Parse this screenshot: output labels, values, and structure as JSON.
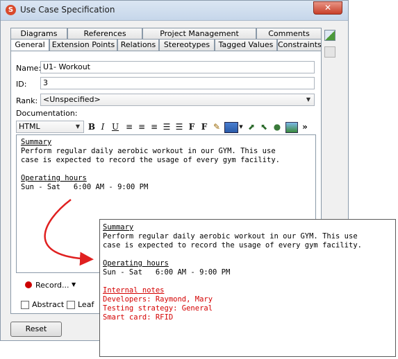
{
  "window": {
    "title": "Use Case Specification",
    "close_glyph": "✕",
    "app_icon": "app-logo-icon"
  },
  "tabs_row1": [
    "Diagrams",
    "References",
    "Project Management",
    "Comments"
  ],
  "tabs_row2": [
    "General",
    "Extension Points",
    "Relations",
    "Stereotypes",
    "Tagged Values",
    "Constraints"
  ],
  "form": {
    "name_label": "Name:",
    "name_value": "U1- Workout",
    "id_label": "ID:",
    "id_value": "3",
    "rank_label": "Rank:",
    "rank_value": "<Unspecified>",
    "documentation_label": "Documentation:"
  },
  "toolbar": {
    "format_value": "HTML",
    "bold": "B",
    "italic": "I",
    "underline": "U",
    "font": "F",
    "font_size": "F",
    "more": "»"
  },
  "documentation": {
    "heading1": "Summary",
    "line1": "Perform regular daily aerobic workout in our GYM. This use",
    "line2": "case is expected to record the usage of every gym facility.",
    "heading2": "Operating hours",
    "hours": "Sun - Sat   6:00 AM - 9:00 PM"
  },
  "popup": {
    "heading1": "Summary",
    "line1": "Perform regular daily aerobic workout in our GYM. This use",
    "line2": "case is expected to record the usage of every gym facility.",
    "heading2": "Operating hours",
    "hours": "Sun - Sat   6:00 AM - 9:00 PM",
    "notes_heading": "Internal notes",
    "note1": "Developers: Raymond, Mary",
    "note2": "Testing strategy: General",
    "note3": "Smart card: RFID"
  },
  "record_label": "Record...",
  "abstract_label": "Abstract",
  "leaf_label": "Leaf",
  "reset_label": "Reset",
  "colors": {
    "accent_red": "#d40000",
    "arrow_red": "#e02020",
    "record_dot": "#cc0000"
  }
}
